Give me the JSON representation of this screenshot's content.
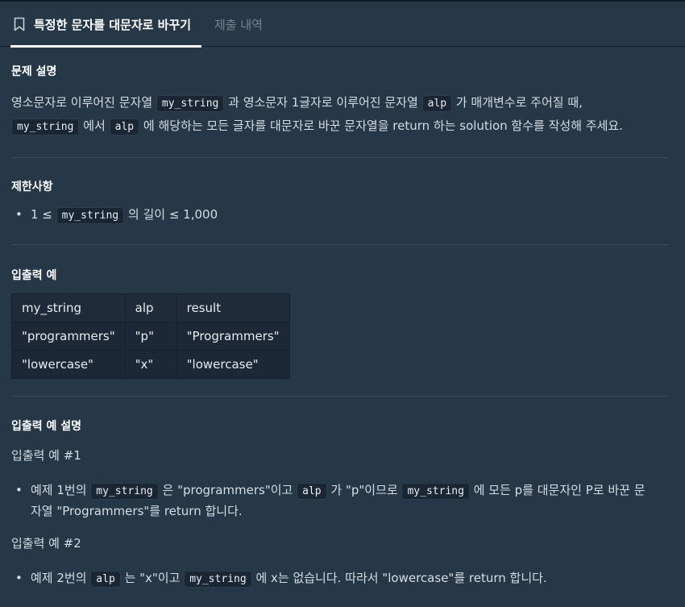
{
  "tabs": {
    "active_label": "특정한 문자를 대문자로 바꾸기",
    "inactive_label": "제출 내역",
    "bookmark_icon": "bookmark-icon"
  },
  "description": {
    "heading": "문제 설명",
    "line1_a": "영소문자로 이루어진 문자열",
    "line1_code1": "my_string",
    "line1_b": "과 영소문자 1글자로 이루어진 문자열",
    "line1_code2": "alp",
    "line1_c": "가 매개변수로 주어질 때,",
    "line2_code1": "my_string",
    "line2_a": "에서",
    "line2_code2": "alp",
    "line2_b": "에 해당하는 모든 글자를 대문자로 바꾼 문자열을 return 하는 solution 함수를 작성해 주세요."
  },
  "constraints": {
    "heading": "제한사항",
    "item_a": "1 ≤",
    "item_code": "my_string",
    "item_b": "의 길이 ≤ 1,000"
  },
  "examples": {
    "heading": "입출력 예",
    "columns": [
      "my_string",
      "alp",
      "result"
    ],
    "rows": [
      [
        "\"programmers\"",
        "\"p\"",
        "\"Programmers\""
      ],
      [
        "\"lowercase\"",
        "\"x\"",
        "\"lowercase\""
      ]
    ]
  },
  "explanation": {
    "heading": "입출력 예 설명",
    "ex1_title": "입출력 예 #1",
    "ex1_a": "예제 1번의",
    "ex1_code1": "my_string",
    "ex1_b": "은 \"programmers\"이고",
    "ex1_code2": "alp",
    "ex1_c": "가 \"p\"이므로",
    "ex1_code3": "my_string",
    "ex1_d": "에 모든 p를 대문자인 P로 바꾼 문",
    "ex1_e": "자열 \"Programmers\"를 return 합니다.",
    "ex2_title": "입출력 예 #2",
    "ex2_a": "예제 2번의",
    "ex2_code1": "alp",
    "ex2_b": "는 \"x\"이고",
    "ex2_code2": "my_string",
    "ex2_c": "에 x는 없습니다. 따라서 \"lowercase\"를 return 합니다."
  }
}
